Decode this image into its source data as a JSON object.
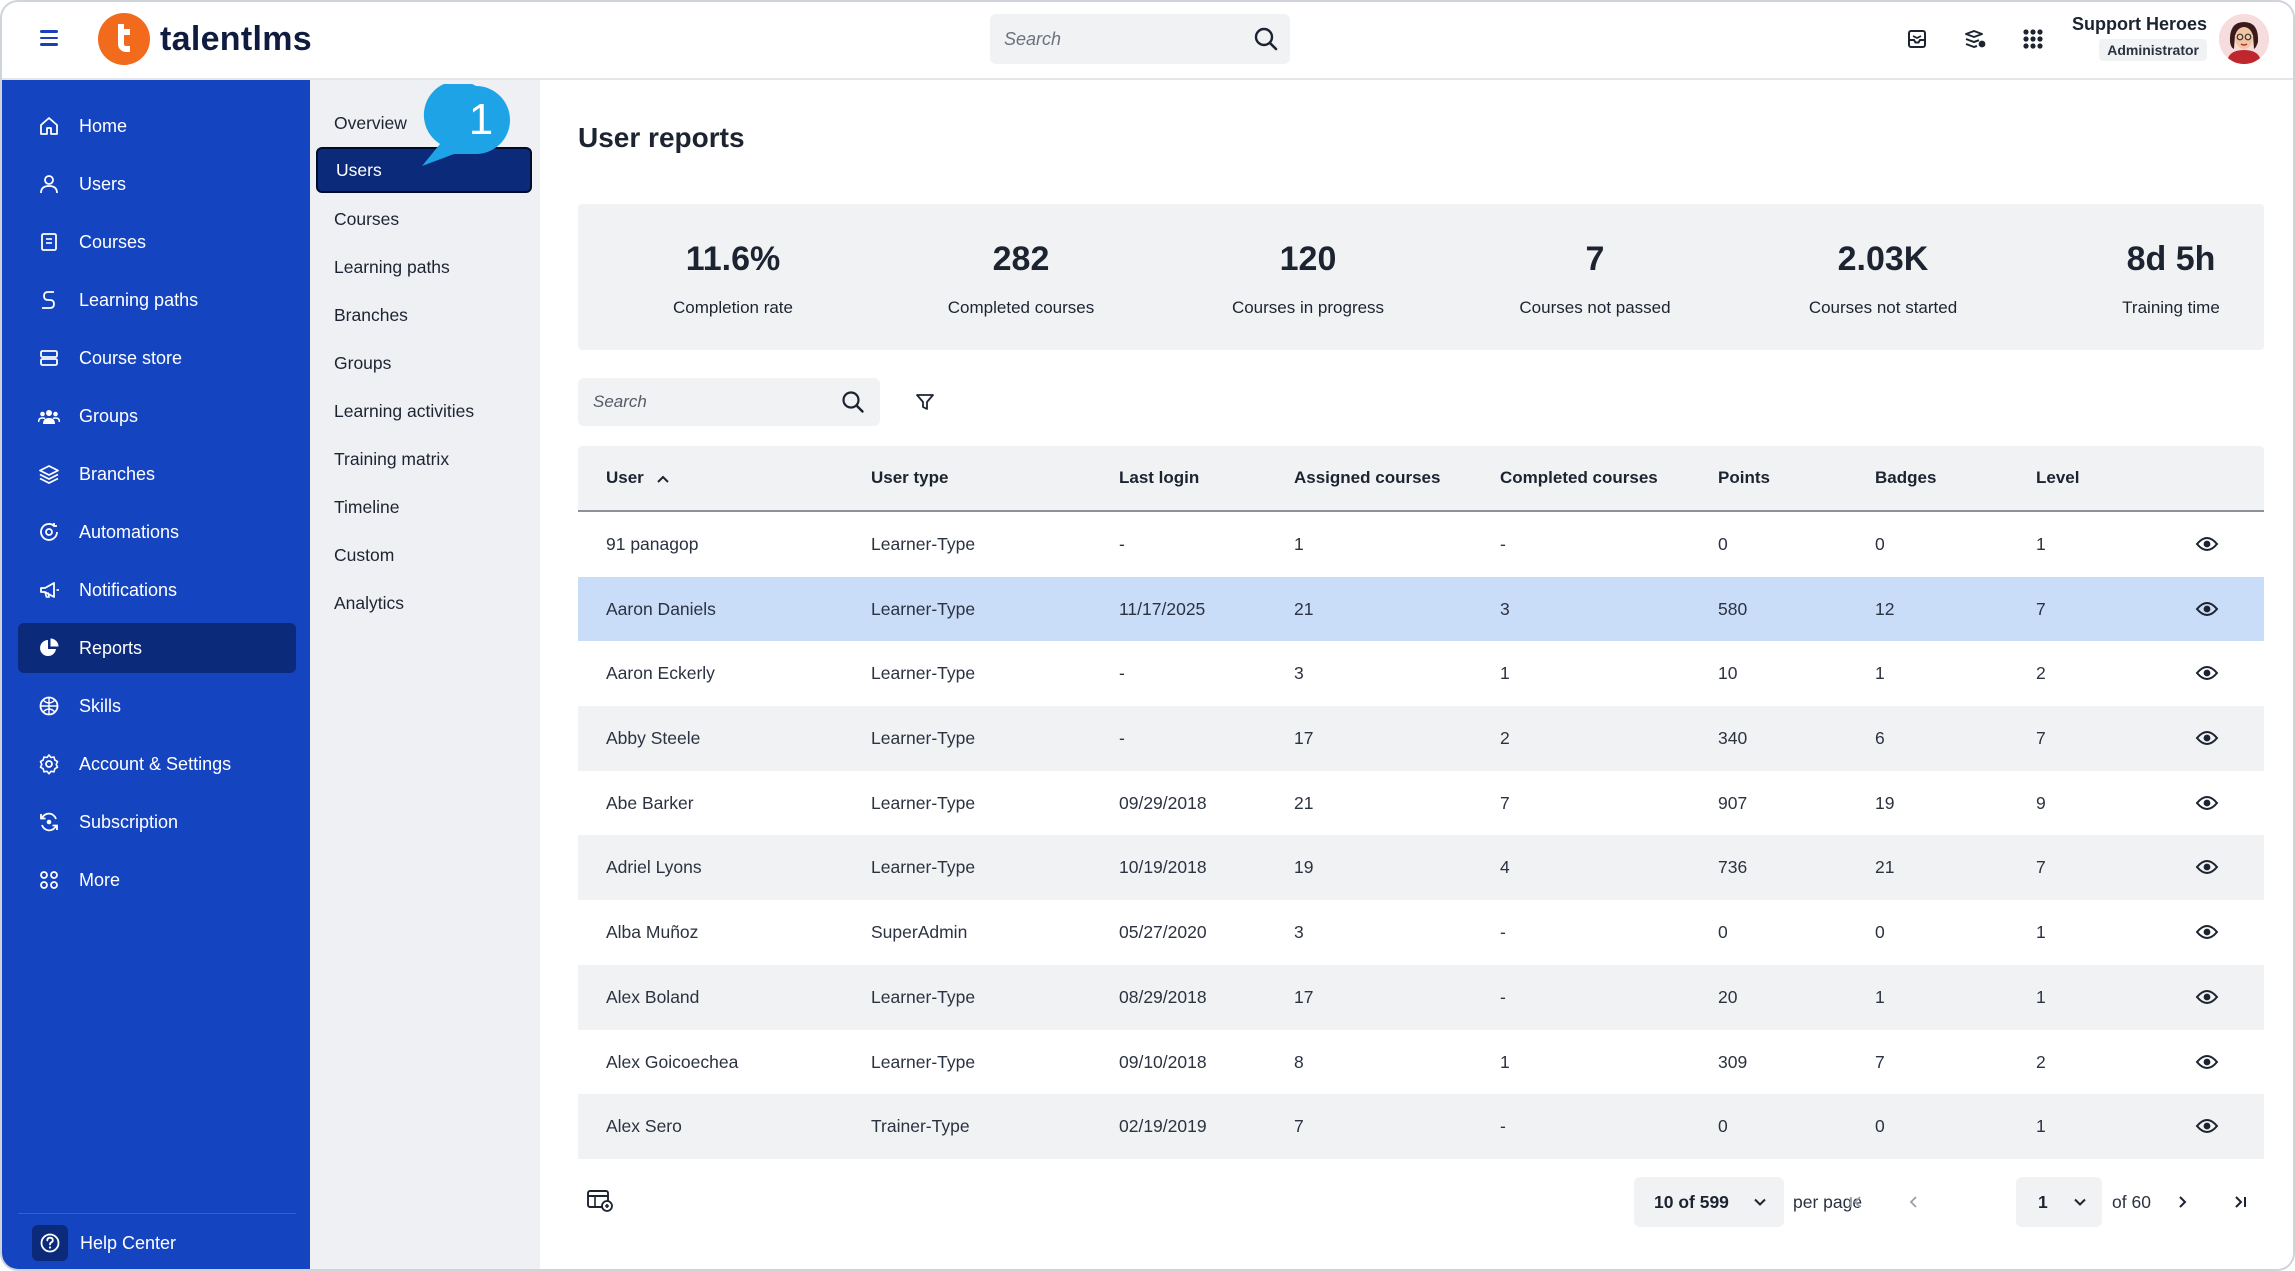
{
  "header": {
    "logo_text": "talentlms",
    "search_placeholder": "Search",
    "user_name": "Support Heroes",
    "user_role": "Administrator",
    "icons": [
      "inbox-icon",
      "messages-icon",
      "apps-grid-icon"
    ]
  },
  "sidebar": {
    "items": [
      {
        "label": "Home",
        "icon": "home-icon"
      },
      {
        "label": "Users",
        "icon": "user-icon"
      },
      {
        "label": "Courses",
        "icon": "book-icon"
      },
      {
        "label": "Learning paths",
        "icon": "path-icon"
      },
      {
        "label": "Course store",
        "icon": "store-icon"
      },
      {
        "label": "Groups",
        "icon": "groups-icon"
      },
      {
        "label": "Branches",
        "icon": "layers-icon"
      },
      {
        "label": "Automations",
        "icon": "automation-icon"
      },
      {
        "label": "Notifications",
        "icon": "megaphone-icon"
      },
      {
        "label": "Reports",
        "icon": "pie-chart-icon",
        "active": true
      },
      {
        "label": "Skills",
        "icon": "skills-icon"
      },
      {
        "label": "Account & Settings",
        "icon": "gear-icon"
      },
      {
        "label": "Subscription",
        "icon": "subscription-icon"
      },
      {
        "label": "More",
        "icon": "more-icon"
      }
    ],
    "help_label": "Help Center"
  },
  "subnav": {
    "items": [
      {
        "label": "Overview"
      },
      {
        "label": "Users",
        "active": true
      },
      {
        "label": "Courses"
      },
      {
        "label": "Learning paths"
      },
      {
        "label": "Branches"
      },
      {
        "label": "Groups"
      },
      {
        "label": "Learning activities"
      },
      {
        "label": "Training matrix"
      },
      {
        "label": "Timeline"
      },
      {
        "label": "Custom"
      },
      {
        "label": "Analytics"
      }
    ],
    "callout_number": "1"
  },
  "main": {
    "title": "User reports",
    "stats": [
      {
        "value": "11.6%",
        "label": "Completion rate"
      },
      {
        "value": "282",
        "label": "Completed courses"
      },
      {
        "value": "120",
        "label": "Courses in progress"
      },
      {
        "value": "7",
        "label": "Courses not passed"
      },
      {
        "value": "2.03K",
        "label": "Courses not started"
      },
      {
        "value": "8d 5h",
        "label": "Training time"
      }
    ],
    "table_search_placeholder": "Search",
    "columns": [
      "User",
      "User type",
      "Last login",
      "Assigned courses",
      "Completed courses",
      "Points",
      "Badges",
      "Level"
    ],
    "rows": [
      [
        "91 panagop",
        "Learner-Type",
        "-",
        "1",
        "-",
        "0",
        "0",
        "1"
      ],
      [
        "Aaron Daniels",
        "Learner-Type",
        "11/17/2025",
        "21",
        "3",
        "580",
        "12",
        "7"
      ],
      [
        "Aaron Eckerly",
        "Learner-Type",
        "-",
        "3",
        "1",
        "10",
        "1",
        "2"
      ],
      [
        "Abby Steele",
        "Learner-Type",
        "-",
        "17",
        "2",
        "340",
        "6",
        "7"
      ],
      [
        "Abe Barker",
        "Learner-Type",
        "09/29/2018",
        "21",
        "7",
        "907",
        "19",
        "9"
      ],
      [
        "Adriel Lyons",
        "Learner-Type",
        "10/19/2018",
        "19",
        "4",
        "736",
        "21",
        "7"
      ],
      [
        "Alba Muñoz",
        "SuperAdmin",
        "05/27/2020",
        "3",
        "-",
        "0",
        "0",
        "1"
      ],
      [
        "Alex Boland",
        "Learner-Type",
        "08/29/2018",
        "17",
        "-",
        "20",
        "1",
        "1"
      ],
      [
        "Alex Goicoechea",
        "Learner-Type",
        "09/10/2018",
        "8",
        "1",
        "309",
        "7",
        "2"
      ],
      [
        "Alex Sero",
        "Trainer-Type",
        "02/19/2019",
        "7",
        "-",
        "0",
        "0",
        "1"
      ]
    ],
    "selected_row": 1,
    "pagination": {
      "per_page_value": "10 of 599",
      "per_page_label": "per page",
      "current_page": "1",
      "of_pages": "of 60"
    }
  },
  "colors": {
    "sidebar": "#1544c0",
    "sidebar_active": "#0b2a7a",
    "brand_orange": "#f26a1b",
    "selected_row": "#c9dcf8",
    "callout": "#1ea4e6"
  }
}
